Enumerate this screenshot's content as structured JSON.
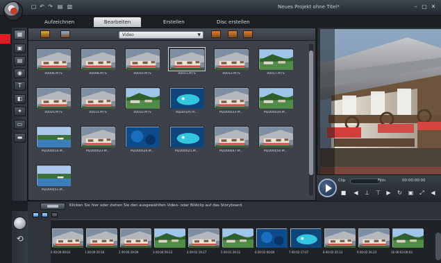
{
  "window": {
    "title": "Neues Projekt ohne Titel*"
  },
  "quick_access": [
    {
      "glyph": "▢",
      "name": "new-project-icon"
    },
    {
      "glyph": "↶",
      "name": "undo-icon"
    },
    {
      "glyph": "↷",
      "name": "redo-icon"
    },
    {
      "glyph": "▤",
      "name": "open-icon"
    },
    {
      "glyph": "▥",
      "name": "save-icon"
    }
  ],
  "window_buttons": [
    {
      "glyph": "–",
      "name": "minimize-icon"
    },
    {
      "glyph": "▢",
      "name": "maximize-icon"
    },
    {
      "glyph": "✕",
      "name": "close-icon"
    }
  ],
  "tabs": [
    {
      "label": "Aufzeichnen",
      "active": false
    },
    {
      "label": "Bearbeiten",
      "active": true
    },
    {
      "label": "Erstellen",
      "active": false
    },
    {
      "label": "Disc erstellen",
      "active": false
    }
  ],
  "left_rail": [
    {
      "name": "media-library-icon",
      "glyph": "▦",
      "active": true
    },
    {
      "name": "video-icon",
      "glyph": "▣",
      "active": false
    },
    {
      "name": "photo-icon",
      "glyph": "▤",
      "active": false
    },
    {
      "name": "audio-icon",
      "glyph": "◉",
      "active": false
    },
    {
      "name": "title-icon",
      "glyph": "T",
      "active": false
    },
    {
      "name": "transition-icon",
      "glyph": "◧",
      "active": false
    },
    {
      "name": "effects-icon",
      "glyph": "✦",
      "active": false
    },
    {
      "name": "subtitle-icon",
      "glyph": "▭",
      "active": false
    },
    {
      "name": "overlay-icon",
      "glyph": "▬",
      "active": false
    }
  ],
  "media": {
    "dropdown_value": "Video",
    "toolbar_icons": [
      {
        "name": "folder-icon",
        "color": "#e3b22d"
      },
      {
        "name": "capture-icon",
        "color": "#8fb6e0"
      },
      {
        "name": "sort-icon",
        "color": "#e57f2e"
      },
      {
        "name": "view-icon",
        "color": "#e57f2e"
      },
      {
        "name": "import-icon",
        "color": "#e57f2e"
      }
    ],
    "items": [
      {
        "label": "00006.MTS",
        "scene": "house"
      },
      {
        "label": "00008.MTS",
        "scene": "house"
      },
      {
        "label": "00010.MTS",
        "scene": "house"
      },
      {
        "label": "00011.MTS",
        "scene": "house",
        "selected": true
      },
      {
        "label": "00012.MTS",
        "scene": "house"
      },
      {
        "label": "00017.MTS",
        "scene": "landscape"
      },
      {
        "label": "00020.MTS",
        "scene": "house"
      },
      {
        "label": "00031.MTS",
        "scene": "house"
      },
      {
        "label": "00033.MTS",
        "scene": "landscape"
      },
      {
        "label": "Aquarium.m...",
        "scene": "aquarium"
      },
      {
        "label": "M2U00033.M...",
        "scene": "house"
      },
      {
        "label": "M2U00034.M...",
        "scene": "landscape"
      },
      {
        "label": "M2U00014.M...",
        "scene": "lake"
      },
      {
        "label": "M2U00023.M...",
        "scene": "house"
      },
      {
        "label": "M2U00024.M...",
        "scene": "water"
      },
      {
        "label": "M2U00025.M...",
        "scene": "aquarium"
      },
      {
        "label": "M2U00047.M...",
        "scene": "house"
      },
      {
        "label": "M2U00050.M...",
        "scene": "house"
      },
      {
        "label": "M2U00051.M...",
        "scene": "lake"
      }
    ]
  },
  "preview": {
    "clip_label": "Clip",
    "project_label": "Film",
    "timecode": "00:00:00:00",
    "controls": [
      {
        "name": "stop-icon",
        "glyph": "■"
      },
      {
        "name": "previous-icon",
        "glyph": "◀"
      },
      {
        "name": "mark-in-icon",
        "glyph": "⊥"
      },
      {
        "name": "mark-out-icon",
        "glyph": "⊤"
      },
      {
        "name": "next-icon",
        "glyph": "▶"
      },
      {
        "name": "repeat-icon",
        "glyph": "↻"
      },
      {
        "name": "snapshot-icon",
        "glyph": "▣"
      },
      {
        "name": "fullscreen-icon",
        "glyph": "⤢"
      },
      {
        "name": "volume-icon",
        "glyph": "◀"
      }
    ]
  },
  "hint": {
    "text": "Klicken Sie hier oder ziehen Sie den ausgewählten Video- oder Bildclip auf das Storyboard."
  },
  "storyboard": {
    "clips": [
      {
        "label": "0 00:00:09:03",
        "scene": "house"
      },
      {
        "label": "1 00:00:20:16",
        "scene": "house"
      },
      {
        "label": "2 00:00:19:09",
        "scene": "house"
      },
      {
        "label": "3 00:00:59:13",
        "scene": "landscape"
      },
      {
        "label": "4 00:01:19:27",
        "scene": "house"
      },
      {
        "label": "5 00:01:39:12",
        "scene": "landscape"
      },
      {
        "label": "6 00:02:00:00",
        "scene": "water"
      },
      {
        "label": "7 00:02:17:07",
        "scene": "aquarium"
      },
      {
        "label": "8 00:02:35:13",
        "scene": "house"
      },
      {
        "label": "9 00:02:36:23",
        "scene": "house"
      },
      {
        "label": "10 00:03:00:03",
        "scene": "landscape"
      }
    ]
  }
}
